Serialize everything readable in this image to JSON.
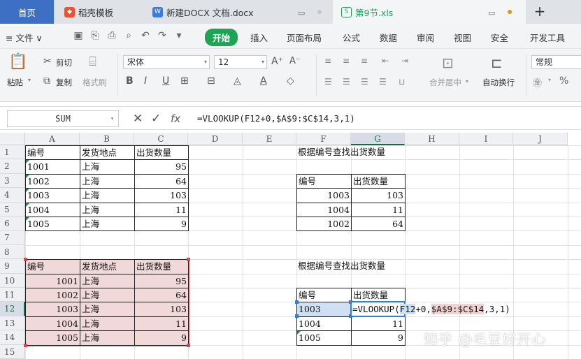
{
  "tabs": {
    "home": "首页",
    "template": "稻壳模板",
    "docx": "新建DOCX 文档.docx",
    "xls": "第9节.xls",
    "add": "+"
  },
  "menu": {
    "file": "≡ 文件 ∨",
    "start": "开始",
    "items": [
      "插入",
      "页面布局",
      "公式",
      "数据",
      "审阅",
      "视图",
      "安全",
      "开发工具"
    ]
  },
  "ribbon": {
    "paste": "粘贴",
    "cut": "剪切",
    "copy": "复制",
    "format_painter": "格式刷",
    "font_name": "宋体",
    "font_size": "12",
    "merge_center": "合并居中",
    "wrap_text": "自动换行",
    "number_format": "常规",
    "percent": "%"
  },
  "formula_bar": {
    "name_box": "SUM",
    "fx": "fx",
    "formula": "=VLOOKUP(F12+0,$A$9:$C$14,3,1)"
  },
  "columns": [
    "A",
    "B",
    "C",
    "D",
    "E",
    "F",
    "G",
    "H",
    "I",
    "J"
  ],
  "rows": [
    "1",
    "2",
    "3",
    "4",
    "5",
    "6",
    "7",
    "8",
    "9",
    "10",
    "11",
    "12",
    "13",
    "14",
    "15"
  ],
  "table1": {
    "headers": [
      "编号",
      "发货地点",
      "出货数量"
    ],
    "rows": [
      [
        "1001",
        "上海",
        "95"
      ],
      [
        "1002",
        "上海",
        "64"
      ],
      [
        "1003",
        "上海",
        "103"
      ],
      [
        "1004",
        "上海",
        "11"
      ],
      [
        "1005",
        "上海",
        "9"
      ]
    ]
  },
  "table2": {
    "headers": [
      "编号",
      "发货地点",
      "出货数量"
    ],
    "rows": [
      [
        "1001",
        "上海",
        "95"
      ],
      [
        "1002",
        "上海",
        "64"
      ],
      [
        "1003",
        "上海",
        "103"
      ],
      [
        "1004",
        "上海",
        "11"
      ],
      [
        "1005",
        "上海",
        "9"
      ]
    ]
  },
  "lookup1": {
    "title": "根据编号查找出货数量",
    "headers": [
      "编号",
      "出货数量"
    ],
    "rows": [
      [
        "1003",
        "103"
      ],
      [
        "1004",
        "11"
      ],
      [
        "1002",
        "64"
      ]
    ]
  },
  "lookup2": {
    "title": "根据编号查找出货数量",
    "headers": [
      "编号",
      "出货数量"
    ],
    "rows": [
      [
        "1003",
        ""
      ],
      [
        "1004",
        "11"
      ],
      [
        "1005",
        "9"
      ]
    ],
    "edit_prefix": "=VLOOKUP(",
    "edit_ref1": "F12",
    "edit_mid": "+0,",
    "edit_ref2": "$A$9:$C$14",
    "edit_suffix": ",3,1)"
  },
  "watermark": "知乎 @毛豆好开心",
  "colors": {
    "accent_blue": "#3d6fc4",
    "start_green": "#1fa355",
    "pink_fill": "#f2d9d9",
    "sel_blue": "#cfe0f5"
  }
}
